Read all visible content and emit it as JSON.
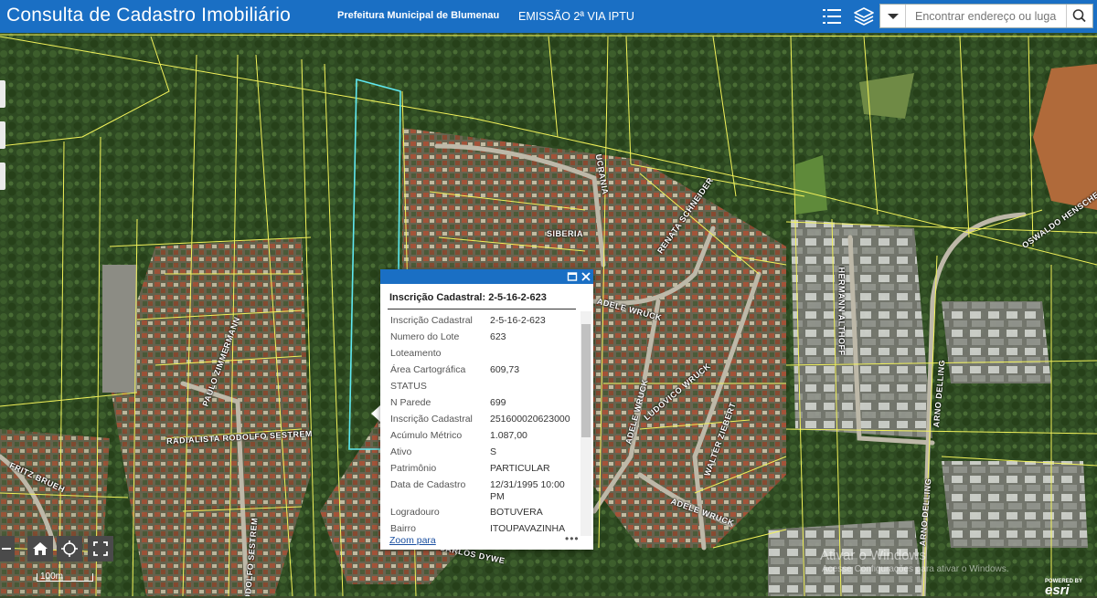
{
  "header": {
    "title": "Consulta de Cadastro Imobiliário",
    "link_prefeitura": "Prefeitura Municipal de Blumenau",
    "link_emissao": "EMISSÃO 2ª VIA IPTU",
    "list_icon": "list-icon",
    "layers_icon": "layers-icon"
  },
  "search": {
    "placeholder": "Encontrar endereço ou luga",
    "dropdown_icon": "caret-down-icon",
    "button_icon": "search-icon"
  },
  "streets": [
    "SIBERIA",
    "UCRANIA",
    "ADELE WRUCK",
    "HERMANN ALTHOFF",
    "ARNO DELLING",
    "RADIALISTA RODOLFO SESTREM",
    "FRITZ BRUEH",
    "ADELE WRUCK",
    "LUDOVICO WRUCK",
    "WALTER ZIEBERT",
    "ADELE WRUCK",
    "PAULO ZIMMERMANN",
    "CARLOS DYWE",
    "ARNO DELLING",
    "OSWALDO HENSCHE",
    "RODOLFO SESTREM",
    "RENATA SCHNEIDER"
  ],
  "popup": {
    "title": "Inscrição Cadastral: 2-5-16-2-623",
    "maximize_icon": "maximize-icon",
    "close_icon": "close-icon",
    "fields": [
      {
        "label": "Inscrição Cadastral",
        "value": "2-5-16-2-623"
      },
      {
        "label": "Numero do Lote",
        "value": "623"
      },
      {
        "label": "Loteamento",
        "value": ""
      },
      {
        "label": "Área Cartográfica",
        "value": "609,73"
      },
      {
        "label": "STATUS",
        "value": ""
      },
      {
        "label": "N Parede",
        "value": "699"
      },
      {
        "label": "Inscrição Cadastral",
        "value": "251600020623000"
      },
      {
        "label": "Acúmulo Métrico",
        "value": "1.087,00"
      },
      {
        "label": "Ativo",
        "value": "S"
      },
      {
        "label": "Patrimônio",
        "value": "PARTICULAR"
      },
      {
        "label": "Data de Cadastro",
        "value": "12/31/1995 10:00 PM"
      },
      {
        "label": "Logradouro",
        "value": "BOTUVERA"
      },
      {
        "label": "Bairro",
        "value": "ITOUPAVAZINHA"
      }
    ],
    "zoom_label": "Zoom para",
    "more_label": "•••"
  },
  "controls": {
    "zoom_out_icon": "minus-icon",
    "home_icon": "home-icon",
    "locate_icon": "locate-icon",
    "fullscreen_icon": "fullscreen-icon"
  },
  "scale_label": "100m",
  "watermark": {
    "line1": "Ativar o Windows",
    "line2": "Acesse Configurações para ativar o Windows."
  },
  "esri": {
    "powered": "POWERED BY",
    "logo": "esri"
  },
  "colors": {
    "header_blue": "#1a6fc4",
    "parcel_yellow": "#f2f25a",
    "selected_parcel": "#5fe8f0"
  }
}
